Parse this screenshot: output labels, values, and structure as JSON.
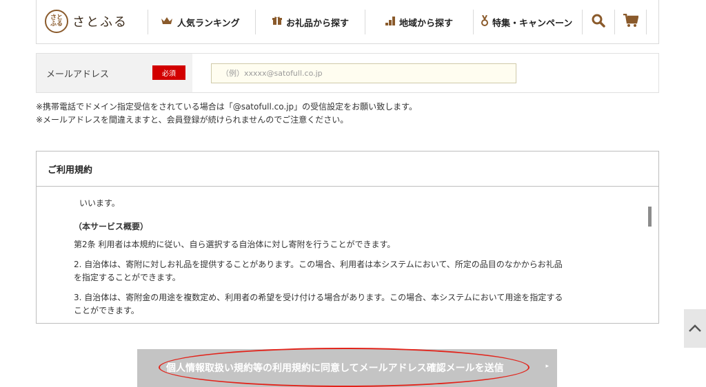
{
  "header": {
    "logo_text": "さとふる",
    "logo_mark": "さと\nふる",
    "nav": [
      {
        "label": "人気ランキング",
        "icon": "crown-icon"
      },
      {
        "label": "お礼品から探す",
        "icon": "gift-icon"
      },
      {
        "label": "地域から探す",
        "icon": "bar-chart-icon"
      },
      {
        "label": "特集・キャンペーン",
        "icon": "medal-icon"
      }
    ],
    "search_icon": "search-icon",
    "cart_icon": "cart-icon",
    "accent_color": "#8a5a2b"
  },
  "email": {
    "label": "メールアドレス",
    "required_badge": "必須",
    "placeholder": "（例）xxxxx@satofull.co.jp",
    "value": ""
  },
  "notes": [
    "※携帯電話でドメイン指定受信をされている場合は「@satofull.co.jp」の受信設定をお願い致します。",
    "※メールアドレスを間違えますと、会員登録が続けられませんのでご注意ください。"
  ],
  "terms": {
    "title": "ご利用規約",
    "lines": [
      "いいます。",
      "（本サービス概要）",
      "第2条 利用者は本規約に従い、自ら選択する自治体に対し寄附を行うことができます。",
      "2. 自治体は、寄附に対しお礼品を提供することがあります。この場合、利用者は本システムにおいて、所定の品目のなかからお礼品",
      "を指定することができます。",
      "3. 自治体は、寄附金の用途を複数定め、利用者の希望を受け付ける場合があります。この場合、本システムにおいて用途を指定する",
      "ことができます。"
    ]
  },
  "back_to_top_icon": "chevron-up-icon",
  "submit": {
    "label": "個人情報取扱い規約等の利用規約に同意してメールアドレス確認メールを送信",
    "arrow": "▸"
  },
  "colors": {
    "required": "#d20000",
    "submit_disabled": "#c4c4c4",
    "annotation": "#e2231a"
  }
}
